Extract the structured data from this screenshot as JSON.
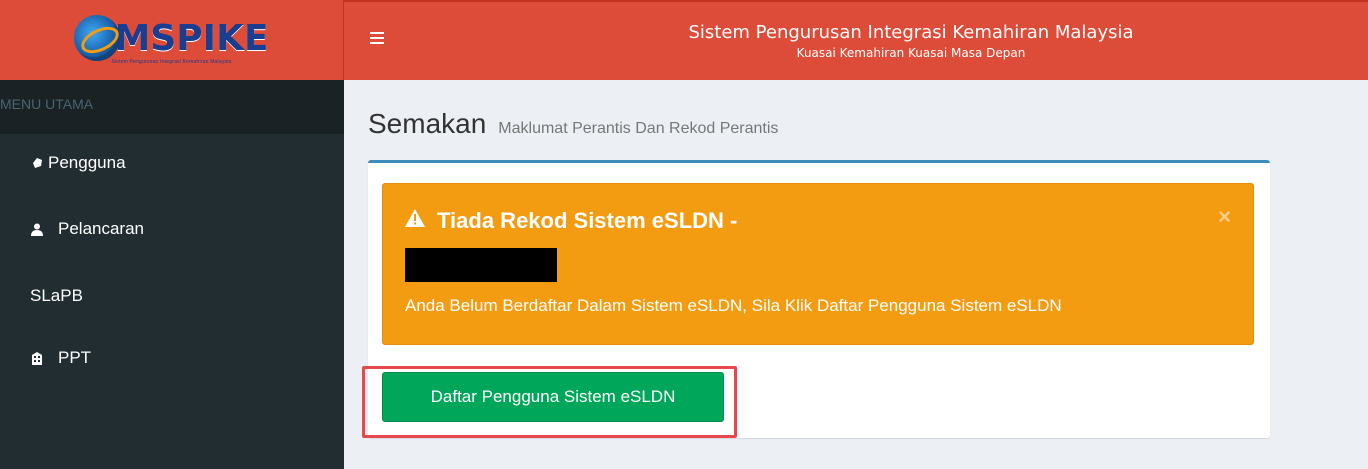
{
  "header": {
    "logo_text": "MSPIKE",
    "logo_sub": "Sistem Pengurusan Integrasi Kemahiran Malaysia",
    "title": "Sistem Pengurusan Integrasi Kemahiran Malaysia",
    "subtitle": "Kuasai Kemahiran Kuasai Masa Depan",
    "menu_icon": "hamburger-icon"
  },
  "sidebar": {
    "header": "MENU UTAMA",
    "items": [
      {
        "label": "Pengguna",
        "icon": "user-gear-icon"
      },
      {
        "label": "Pelancaran",
        "icon": "user-icon"
      },
      {
        "label": "SLaPB",
        "icon": ""
      },
      {
        "label": "PPT",
        "icon": "building-icon"
      }
    ]
  },
  "main": {
    "title": "Semakan",
    "subtitle": "Maklumat Perantis Dan Rekod Perantis"
  },
  "alert": {
    "title": "Tiada Rekod Sistem eSLDN -",
    "message": "Anda Belum Berdaftar Dalam Sistem eSLDN, Sila Klik Daftar Pengguna Sistem eSLDN",
    "close": "×",
    "icon": "warning-icon"
  },
  "button": {
    "label": "Daftar Pengguna Sistem eSLDN"
  },
  "colors": {
    "header_red": "#dd4b39",
    "sidebar_dark": "#222d32",
    "alert_orange": "#f39c12",
    "success_green": "#00a65a",
    "highlight_red": "#e8474d"
  }
}
